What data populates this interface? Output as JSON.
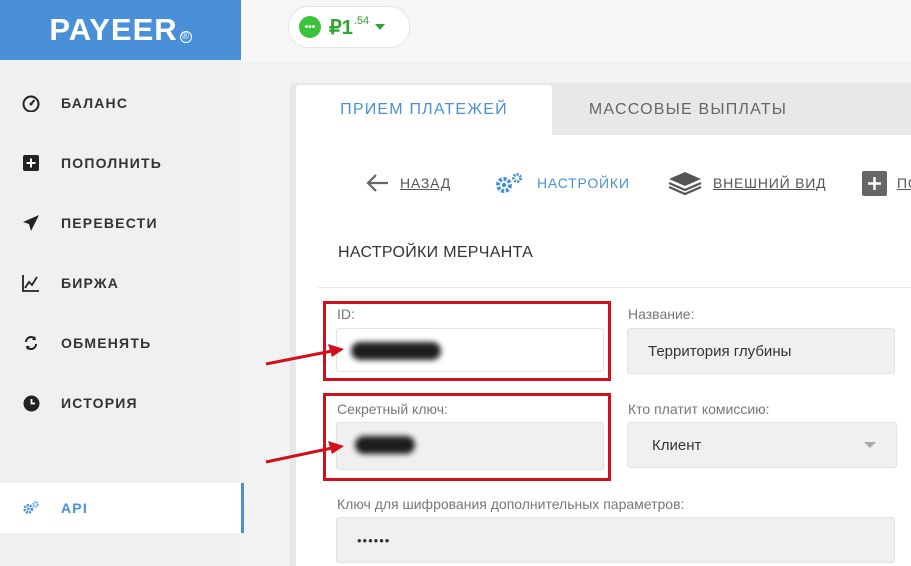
{
  "app": {
    "logo_text": "PAYEER",
    "logo_mark": "®",
    "accent": "#4a90d9"
  },
  "sidebar": {
    "items": [
      {
        "label": "БАЛАНС",
        "icon": "gauge-icon"
      },
      {
        "label": "ПОПОЛНИТЬ",
        "icon": "plus-square-icon"
      },
      {
        "label": "ПЕРЕВЕСТИ",
        "icon": "paper-plane-icon"
      },
      {
        "label": "БИРЖА",
        "icon": "chart-icon"
      },
      {
        "label": "ОБМЕНЯТЬ",
        "icon": "exchange-icon"
      },
      {
        "label": "ИСТОРИЯ",
        "icon": "clock-icon"
      },
      {
        "label": "API",
        "icon": "gears-icon"
      }
    ]
  },
  "balance": {
    "currency_symbol": "₽",
    "integer": "1",
    "decimal": ".54",
    "status_color": "#3cc33c"
  },
  "tabs": [
    {
      "label": "ПРИЕМ ПЛАТЕЖЕЙ"
    },
    {
      "label": "МАССОВЫЕ ВЫПЛАТЫ"
    }
  ],
  "subnav": {
    "back": "НАЗАД",
    "settings": "НАСТРОЙКИ",
    "appearance": "ВНЕШНИЙ ВИД",
    "more": "ПО"
  },
  "section_title": "НАСТРОЙКИ МЕРЧАНТА",
  "form": {
    "id_label": "ID:",
    "name_label": "Название:",
    "name_value": "Территория глубины",
    "secret_label": "Секретный ключ:",
    "commission_label": "Кто платит комиссию:",
    "commission_value": "Клиент",
    "encrypt_label": "Ключ для шифрования дополнительных параметров:",
    "encrypt_value": "••••••"
  },
  "annotation_color": "#d0101a"
}
